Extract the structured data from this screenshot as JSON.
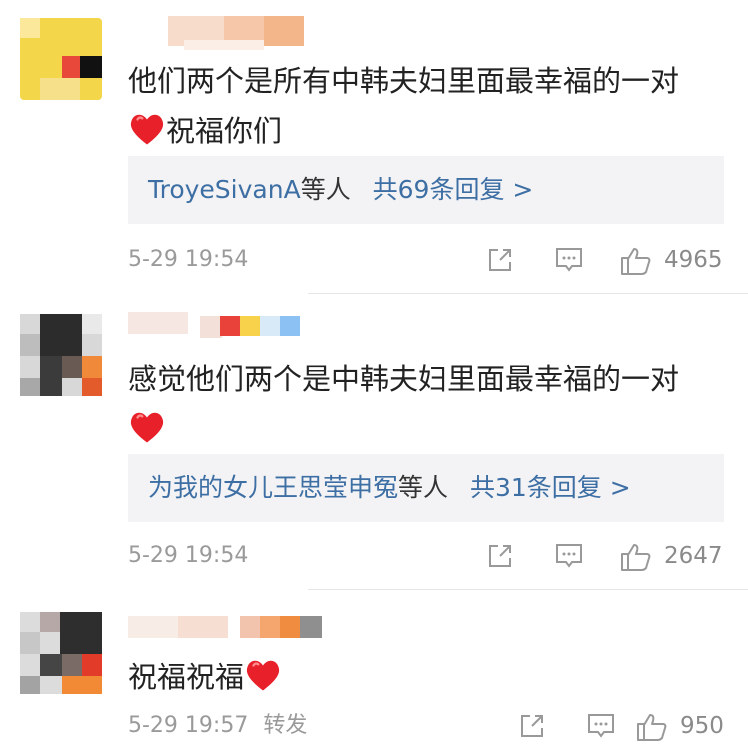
{
  "comments": [
    {
      "content": "他们两个是所有中韩夫妇里面最幸福的一对",
      "content2": "祝福你们",
      "reply": {
        "users": "TroyeSivanA",
        "etc": "等人",
        "count_label": "共69条回复 >"
      },
      "time": "5-29 19:54",
      "likes": "4965"
    },
    {
      "content": "感觉他们两个是中韩夫妇里面最幸福的一对",
      "reply": {
        "users": "为我的女儿王思莹申冤",
        "etc": "等人",
        "count_label": "共31条回复 >"
      },
      "time": "5-29 19:54",
      "likes": "2647"
    },
    {
      "content": "祝福祝福",
      "time": "5-29 19:57",
      "forward": "转发",
      "likes": "950"
    }
  ],
  "colors": {
    "link": "#3d6fa4",
    "heart": "#e8202a",
    "meta": "#9a9a9a"
  },
  "icons": [
    "share-icon",
    "comment-icon",
    "like-icon",
    "heart-emoji-icon"
  ]
}
